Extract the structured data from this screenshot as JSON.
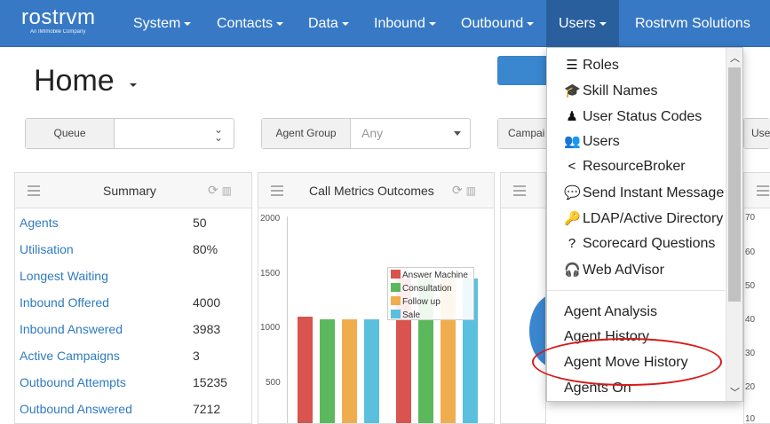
{
  "logo": {
    "main": "rostrvm",
    "sub": "An IMImobile Company"
  },
  "nav": [
    {
      "label": "System",
      "caret": true
    },
    {
      "label": "Contacts",
      "caret": true
    },
    {
      "label": "Data",
      "caret": true
    },
    {
      "label": "Inbound",
      "caret": true
    },
    {
      "label": "Outbound",
      "caret": true
    },
    {
      "label": "Users",
      "caret": true,
      "active": true
    },
    {
      "label": "Rostrvm Solutions",
      "caret": false
    }
  ],
  "page": {
    "title": "Home"
  },
  "filters": {
    "queue": {
      "label": "Queue",
      "value": ""
    },
    "agent_group": {
      "label": "Agent Group",
      "value": "Any"
    },
    "campaign": {
      "label": "Campai"
    },
    "user": {
      "label": "Use"
    }
  },
  "summary": {
    "title": "Summary",
    "rows": [
      {
        "label": "Agents",
        "value": "50"
      },
      {
        "label": "Utilisation",
        "value": "80%"
      },
      {
        "label": "Longest Waiting",
        "value": ""
      },
      {
        "label": "Inbound Offered",
        "value": "4000"
      },
      {
        "label": "Inbound Answered",
        "value": "3983"
      },
      {
        "label": "Active Campaigns",
        "value": "3"
      },
      {
        "label": "Outbound Attempts",
        "value": "15235"
      },
      {
        "label": "Outbound Answered",
        "value": "7212"
      }
    ]
  },
  "call_metrics": {
    "title": "Call Metrics Outcomes",
    "y_ticks": [
      "2000",
      "1500",
      "1000",
      "500"
    ]
  },
  "right_panel": {
    "y_ticks": [
      "70",
      "60",
      "50",
      "40",
      "30",
      "20",
      "10"
    ]
  },
  "chart_data": {
    "type": "bar",
    "categories": [
      "",
      ""
    ],
    "ylim": [
      0,
      2000
    ],
    "series": [
      {
        "name": "Answer Machine",
        "values": [
          1100,
          1450
        ]
      },
      {
        "name": "Consultation",
        "values": [
          1080,
          1450
        ]
      },
      {
        "name": "Follow up",
        "values": [
          1075,
          1450
        ]
      },
      {
        "name": "Sale",
        "values": [
          1080,
          1450
        ]
      }
    ],
    "colors": [
      "#d9534f",
      "#5cb85c",
      "#f0ad4e",
      "#5bc0de"
    ],
    "legend_position": "top-right"
  },
  "users_menu": {
    "items": [
      {
        "label": "Roles",
        "icon": "tasks-icon",
        "glyph": "☰"
      },
      {
        "label": "Skill Names",
        "icon": "graduation-cap-icon",
        "glyph": "🎓"
      },
      {
        "label": "User Status Codes",
        "icon": "street-view-icon",
        "glyph": "♟"
      },
      {
        "label": "Users",
        "icon": "users-icon",
        "glyph": "👥"
      },
      {
        "label": "ResourceBroker",
        "icon": "share-alt-icon",
        "glyph": "<"
      },
      {
        "label": "Send Instant Message",
        "icon": "comment-icon",
        "glyph": "💬"
      },
      {
        "label": "LDAP/Active Directory",
        "icon": "key-icon",
        "glyph": "🔑"
      },
      {
        "label": "Scorecard Questions",
        "icon": "question-icon",
        "glyph": "?"
      },
      {
        "label": "Web AdVisor",
        "icon": "headset-icon",
        "glyph": "🎧"
      }
    ],
    "reports": [
      {
        "label": "Agent Analysis"
      },
      {
        "label": "Agent History"
      },
      {
        "label": "Agent Move History"
      },
      {
        "label": "Agents On"
      }
    ]
  }
}
